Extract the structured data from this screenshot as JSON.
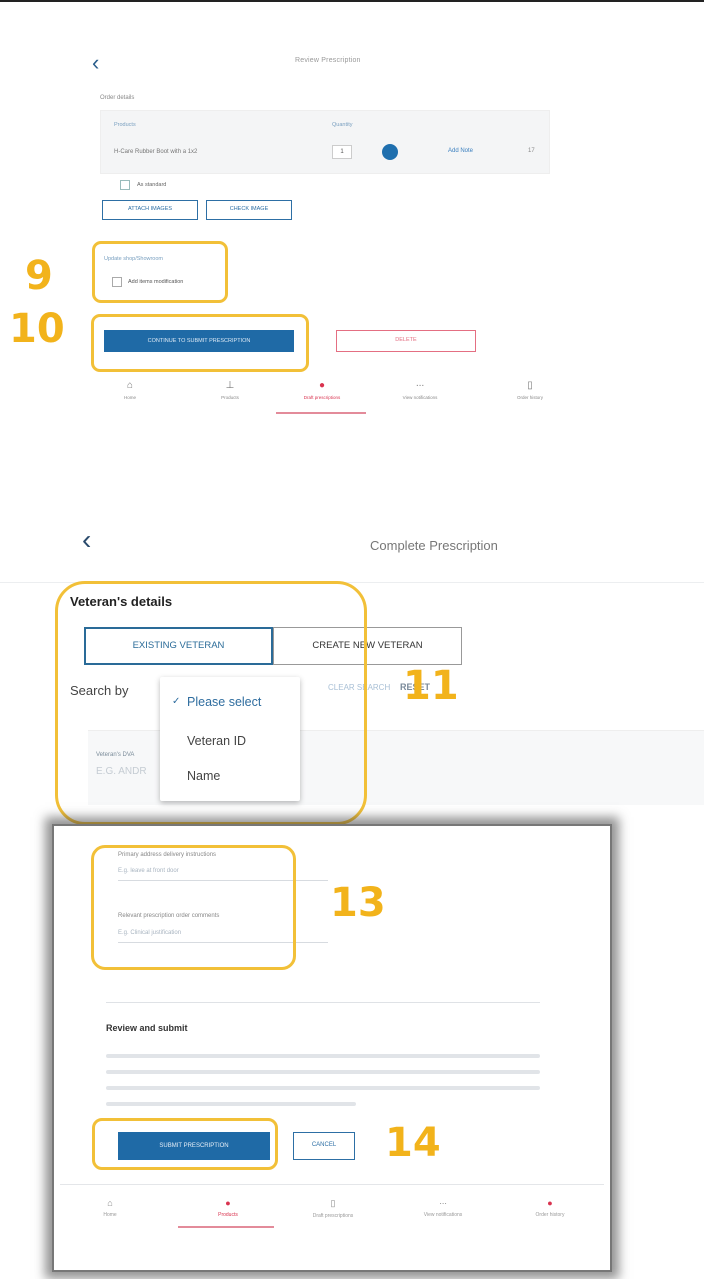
{
  "panel1": {
    "title": "Review Prescription",
    "section": "Order details",
    "table": {
      "col_product": "Products",
      "col_quantity": "Quantity",
      "product_name": "H-Care Rubber Boot with a 1x2",
      "quantity": "1",
      "add_link": "Add Note",
      "count": "17"
    },
    "checkbox_label": "As standard",
    "btn_left": "ATTACH IMAGES",
    "btn_right": "CHECK IMAGE",
    "address_section": "Update shop/Showroom",
    "address_label": "Add items modification",
    "continue_button": "CONTINUE TO SUBMIT PRESCRIPTION",
    "delete_button": "DELETE",
    "nav": [
      {
        "icon": "home-icon",
        "glyph": "⌂",
        "label": "Home"
      },
      {
        "icon": "products-icon",
        "glyph": "⊥",
        "label": "Products"
      },
      {
        "icon": "prescriptions-icon",
        "glyph": "●",
        "label": "Draft prescriptions"
      },
      {
        "icon": "notifications-icon",
        "glyph": "∙∙∙",
        "label": "View notifications"
      },
      {
        "icon": "history-icon",
        "glyph": "▯",
        "label": "Order history"
      }
    ]
  },
  "callouts": {
    "n9": "9",
    "n10": "10",
    "n11": "11",
    "n13": "13",
    "n14": "14"
  },
  "panel2": {
    "title": "Complete Prescription",
    "section": "Veteran's details",
    "tab_existing": "EXISTING VETERAN",
    "tab_create": "CREATE NEW VETERAN",
    "search_by": "Search by",
    "clear_search": "CLEAR SEARCH",
    "reset": "RESET",
    "veteran_label": "Veteran's DVA",
    "veteran_placeholder": "E.G. ANDR",
    "dropdown": {
      "selected": "Please select",
      "options": [
        "Veteran ID",
        "Name"
      ]
    }
  },
  "panel3": {
    "field1_label": "Primary address delivery instructions",
    "field1_placeholder": "E.g. leave at front door",
    "field2_label": "Relevant prescription order comments",
    "field2_placeholder": "E.g. Clinical justification",
    "review_title": "Review and submit",
    "submit_button": "SUBMIT PRESCRIPTION",
    "cancel_button": "CANCEL",
    "nav": [
      {
        "icon": "home-icon",
        "glyph": "⌂",
        "label": "Home"
      },
      {
        "icon": "products-icon",
        "glyph": "●",
        "label": "Products"
      },
      {
        "icon": "prescriptions-icon",
        "glyph": "▯",
        "label": "Draft prescriptions"
      },
      {
        "icon": "notifications-icon",
        "glyph": "∙∙∙",
        "label": "View notifications"
      },
      {
        "icon": "history-icon",
        "glyph": "●",
        "label": "Order history"
      }
    ]
  },
  "colors": {
    "accent": "#1f6aa6",
    "danger": "#d9334f",
    "highlight": "#f2c038"
  }
}
